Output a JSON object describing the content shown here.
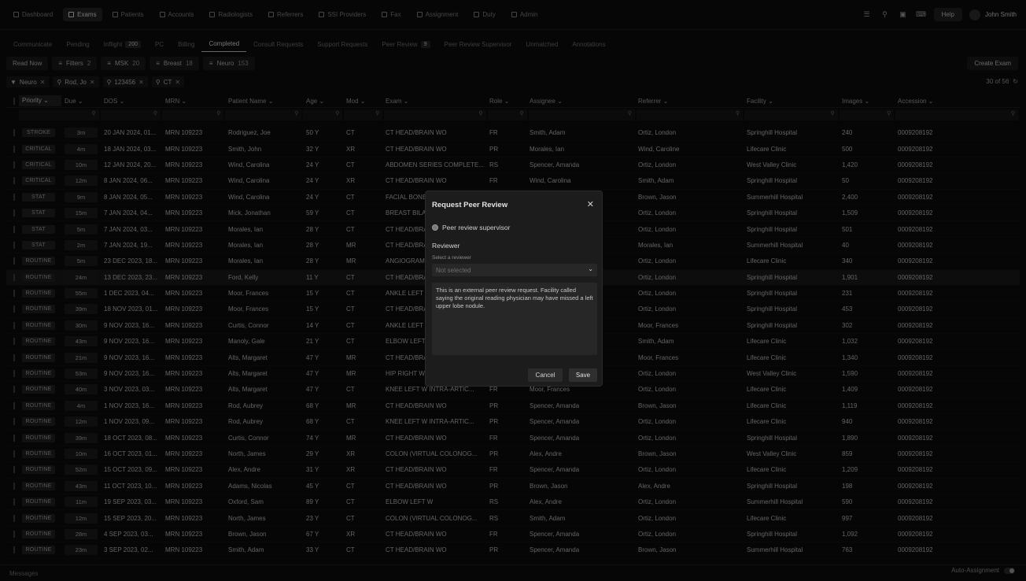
{
  "nav": {
    "items": [
      {
        "label": "Dashboard",
        "icon": "dashboard-icon",
        "active": false
      },
      {
        "label": "Exams",
        "icon": "exams-icon",
        "active": true
      },
      {
        "label": "Patients",
        "icon": "patients-icon",
        "active": false
      },
      {
        "label": "Accounts",
        "icon": "accounts-icon",
        "active": false
      },
      {
        "label": "Radiologists",
        "icon": "radiologists-icon",
        "active": false
      },
      {
        "label": "Referrers",
        "icon": "referrers-icon",
        "active": false
      },
      {
        "label": "SSI Providers",
        "icon": "providers-icon",
        "active": false
      },
      {
        "label": "Fax",
        "icon": "fax-icon",
        "active": false
      },
      {
        "label": "Assignment",
        "icon": "assignment-icon",
        "active": false
      },
      {
        "label": "Duty",
        "icon": "duty-icon",
        "active": false
      },
      {
        "label": "Admin",
        "icon": "admin-icon",
        "active": false
      }
    ],
    "help": "Help",
    "user": "John Smith"
  },
  "subtabs": [
    {
      "label": "Communicate",
      "badge": ""
    },
    {
      "label": "Pending",
      "badge": ""
    },
    {
      "label": "Inflight",
      "badge": "200"
    },
    {
      "label": "PC",
      "badge": ""
    },
    {
      "label": "Billing",
      "badge": ""
    },
    {
      "label": "Completed",
      "badge": "",
      "active": true
    },
    {
      "label": "Consult Requests",
      "badge": ""
    },
    {
      "label": "Support Requests",
      "badge": ""
    },
    {
      "label": "Peer Review",
      "badge": "9"
    },
    {
      "label": "Peer Review Supervisor",
      "badge": ""
    },
    {
      "label": "Unmatched",
      "badge": ""
    },
    {
      "label": "Annotations",
      "badge": ""
    }
  ],
  "toolbar": {
    "read_now": "Read Now",
    "chips": [
      {
        "label": "Filters",
        "count": "2"
      },
      {
        "label": "MSK",
        "count": "20"
      },
      {
        "label": "Breast",
        "count": "18"
      },
      {
        "label": "Neuro",
        "count": "153"
      }
    ],
    "create_exam": "Create Exam"
  },
  "tags": [
    "Neuro",
    "Rod, Jo",
    "123456",
    "CT"
  ],
  "pager": "30 of 56",
  "columns": [
    "Priority",
    "Due",
    "DOS",
    "MRN",
    "Patient Name",
    "Age",
    "Mod",
    "Exam",
    "Role",
    "Assignee",
    "Referrer",
    "Facility",
    "Images",
    "Accession"
  ],
  "rows": [
    [
      "STROKE",
      "3m",
      "20 JAN 2024, 01...",
      "MRN 109223",
      "Rodriguez, Joe",
      "50 Y",
      "CT",
      "CT HEAD/BRAIN WO",
      "FR",
      "Smith, Adam",
      "Ortiz, London",
      "Springhill Hospital",
      "240",
      "0009208192"
    ],
    [
      "CRITICAL",
      "4m",
      "18 JAN 2024, 03...",
      "MRN 109223",
      "Smith, John",
      "32 Y",
      "XR",
      "CT HEAD/BRAIN WO",
      "PR",
      "Morales, Ian",
      "Wind, Caroline",
      "Lifecare Clinic",
      "500",
      "0009208192"
    ],
    [
      "CRITICAL",
      "10m",
      "12 JAN 2024, 20...",
      "MRN 109223",
      "Wind, Carolina",
      "24 Y",
      "CT",
      "ABDOMEN SERIES COMPLETE...",
      "RS",
      "Spencer, Amanda",
      "Ortiz, London",
      "West Valley Clinic",
      "1,420",
      "0009208192"
    ],
    [
      "CRITICAL",
      "12m",
      "8 JAN 2024, 06...",
      "MRN 109223",
      "Wind, Carolina",
      "24 Y",
      "XR",
      "CT HEAD/BRAIN WO",
      "FR",
      "Wind, Carolina",
      "Smith, Adam",
      "Springhill Hospital",
      "50",
      "0009208192"
    ],
    [
      "STAT",
      "9m",
      "8 JAN 2024, 05...",
      "MRN 109223",
      "Wind, Carolina",
      "24 Y",
      "CT",
      "FACIAL BONES...",
      "",
      "",
      "Brown, Jason",
      "Summerhill Hospital",
      "2,400",
      "0009208192"
    ],
    [
      "STAT",
      "15m",
      "7 JAN 2024, 04...",
      "MRN 109223",
      "Mick, Jonathan",
      "59 Y",
      "CT",
      "BREAST BILAT...",
      "",
      "",
      "Ortiz, London",
      "Springhill Hospital",
      "1,509",
      "0009208192"
    ],
    [
      "STAT",
      "5m",
      "7 JAN 2024, 03...",
      "MRN 109223",
      "Morales, Ian",
      "28 Y",
      "CT",
      "CT HEAD/BRA...",
      "",
      "",
      "Ortiz, London",
      "Springhill Hospital",
      "501",
      "0009208192"
    ],
    [
      "STAT",
      "2m",
      "7 JAN 2024, 19...",
      "MRN 109223",
      "Morales, Ian",
      "28 Y",
      "MR",
      "CT HEAD/BRA...",
      "",
      "",
      "Morales, Ian",
      "Summerhill Hospital",
      "40",
      "0009208192"
    ],
    [
      "ROUTINE",
      "5m",
      "23 DEC 2023, 18...",
      "MRN 109223",
      "Morales, Ian",
      "28 Y",
      "MR",
      "ANGIOGRAM A...",
      "",
      "",
      "Ortiz, London",
      "Lifecare Clinic",
      "340",
      "0009208192"
    ],
    [
      "ROUTINE",
      "24m",
      "13 DEC 2023, 23...",
      "MRN 109223",
      "Ford, Kelly",
      "11 Y",
      "CT",
      "CT HEAD/BRA...",
      "",
      "",
      "Ortiz, London",
      "Springhill Hospital",
      "1,901",
      "0009208192"
    ],
    [
      "ROUTINE",
      "55m",
      "1 DEC 2023, 04...",
      "MRN 109223",
      "Moor, Frances",
      "15 Y",
      "CT",
      "ANKLE LEFT W...",
      "",
      "",
      "Ortiz, London",
      "Springhill Hospital",
      "231",
      "0009208192"
    ],
    [
      "ROUTINE",
      "39m",
      "18 NOV 2023, 01...",
      "MRN 109223",
      "Moor, Frances",
      "15 Y",
      "CT",
      "CT HEAD/BRA...",
      "",
      "",
      "Ortiz, London",
      "Springhill Hospital",
      "453",
      "0009208192"
    ],
    [
      "ROUTINE",
      "30m",
      "9 NOV 2023, 16...",
      "MRN 109223",
      "Curtis, Connor",
      "14 Y",
      "CT",
      "ANKLE LEFT W...",
      "",
      "",
      "Moor, Frances",
      "Springhill Hospital",
      "302",
      "0009208192"
    ],
    [
      "ROUTINE",
      "43m",
      "9 NOV 2023, 16...",
      "MRN 109223",
      "Manoly, Gale",
      "21 Y",
      "CT",
      "ELBOW LEFT W...",
      "",
      "",
      "Smith, Adam",
      "Lifecare Clinic",
      "1,032",
      "0009208192"
    ],
    [
      "ROUTINE",
      "21m",
      "9 NOV 2023, 16...",
      "MRN 109223",
      "Alts, Margaret",
      "47 Y",
      "MR",
      "CT HEAD/BRA...",
      "",
      "",
      "Moor, Frances",
      "Lifecare Clinic",
      "1,340",
      "0009208192"
    ],
    [
      "ROUTINE",
      "53m",
      "9 NOV 2023, 16...",
      "MRN 109223",
      "Alts, Margaret",
      "47 Y",
      "MR",
      "HIP RIGHT W...",
      "",
      "",
      "Ortiz, London",
      "West Valley Clinic",
      "1,590",
      "0009208192"
    ],
    [
      "ROUTINE",
      "40m",
      "3 NOV 2023, 03...",
      "MRN 109223",
      "Alts, Margaret",
      "47 Y",
      "CT",
      "KNEE LEFT W INTRA-ARTIC...",
      "FR",
      "Moor, Frances",
      "Ortiz, London",
      "Lifecare Clinic",
      "1,409",
      "0009208192"
    ],
    [
      "ROUTINE",
      "4m",
      "1 NOV 2023, 16...",
      "MRN 109223",
      "Rod, Aubrey",
      "68 Y",
      "MR",
      "CT HEAD/BRAIN WO",
      "PR",
      "Spencer, Amanda",
      "Brown, Jason",
      "Lifecare Clinic",
      "1,119",
      "0009208192"
    ],
    [
      "ROUTINE",
      "12m",
      "1 NOV 2023, 09...",
      "MRN 109223",
      "Rod, Aubrey",
      "68 Y",
      "CT",
      "KNEE LEFT W INTRA-ARTIC...",
      "PR",
      "Spencer, Amanda",
      "Ortiz, London",
      "Lifecare Clinic",
      "940",
      "0009208192"
    ],
    [
      "ROUTINE",
      "39m",
      "18 OCT 2023, 08...",
      "MRN 109223",
      "Curtis, Connor",
      "74 Y",
      "MR",
      "CT HEAD/BRAIN WO",
      "FR",
      "Spencer, Amanda",
      "Ortiz, London",
      "Springhill Hospital",
      "1,890",
      "0009208192"
    ],
    [
      "ROUTINE",
      "10m",
      "16 OCT 2023, 01...",
      "MRN 109223",
      "North, James",
      "29 Y",
      "XR",
      "COLON (VIRTUAL COLONOG...",
      "PR",
      "Alex, Andre",
      "Brown, Jason",
      "West Valley Clinic",
      "859",
      "0009208192"
    ],
    [
      "ROUTINE",
      "52m",
      "15 OCT 2023, 09...",
      "MRN 109223",
      "Alex, Andre",
      "31 Y",
      "XR",
      "CT HEAD/BRAIN WO",
      "FR",
      "Spencer, Amanda",
      "Ortiz, London",
      "Lifecare Clinic",
      "1,209",
      "0009208192"
    ],
    [
      "ROUTINE",
      "43m",
      "11 OCT 2023, 10...",
      "MRN 109223",
      "Adams, Nicolas",
      "45 Y",
      "CT",
      "CT HEAD/BRAIN WO",
      "PR",
      "Brown, Jason",
      "Alex, Andre",
      "Springhill Hospital",
      "198",
      "0009208192"
    ],
    [
      "ROUTINE",
      "11m",
      "19 SEP 2023, 03...",
      "MRN 109223",
      "Oxford, Sam",
      "89 Y",
      "CT",
      "ELBOW LEFT W",
      "RS",
      "Alex, Andre",
      "Ortiz, London",
      "Summerhill Hospital",
      "590",
      "0009208192"
    ],
    [
      "ROUTINE",
      "12m",
      "15 SEP 2023, 20...",
      "MRN 109223",
      "North, James",
      "23 Y",
      "CT",
      "COLON (VIRTUAL COLONOG...",
      "RS",
      "Smith, Adam",
      "Ortiz, London",
      "Lifecare Clinic",
      "997",
      "0009208192"
    ],
    [
      "ROUTINE",
      "28m",
      "4 SEP 2023, 03...",
      "MRN 109223",
      "Brown, Jason",
      "67 Y",
      "XR",
      "CT HEAD/BRAIN WO",
      "FR",
      "Spencer, Amanda",
      "Ortiz, London",
      "Springhill Hospital",
      "1,092",
      "0009208192"
    ],
    [
      "ROUTINE",
      "23m",
      "3 SEP 2023, 02...",
      "MRN 109223",
      "Smith, Adam",
      "33 Y",
      "CT",
      "CT HEAD/BRAIN WO",
      "PR",
      "Spencer, Amanda",
      "Brown, Jason",
      "Summerhill Hospital",
      "763",
      "0009208192"
    ]
  ],
  "footer": {
    "messages": "Messages",
    "auto_assignment": "Auto-Assignment"
  },
  "modal": {
    "title": "Request Peer Review",
    "radio_label": "Peer review supervisor",
    "reviewer_label": "Reviewer",
    "select_hint": "Select a reviewer",
    "select_value": "Not selected",
    "note": "This is an external peer review request. Facility called saying the original reading physician may have missed a left upper lobe nodule.",
    "cancel": "Cancel",
    "save": "Save"
  }
}
